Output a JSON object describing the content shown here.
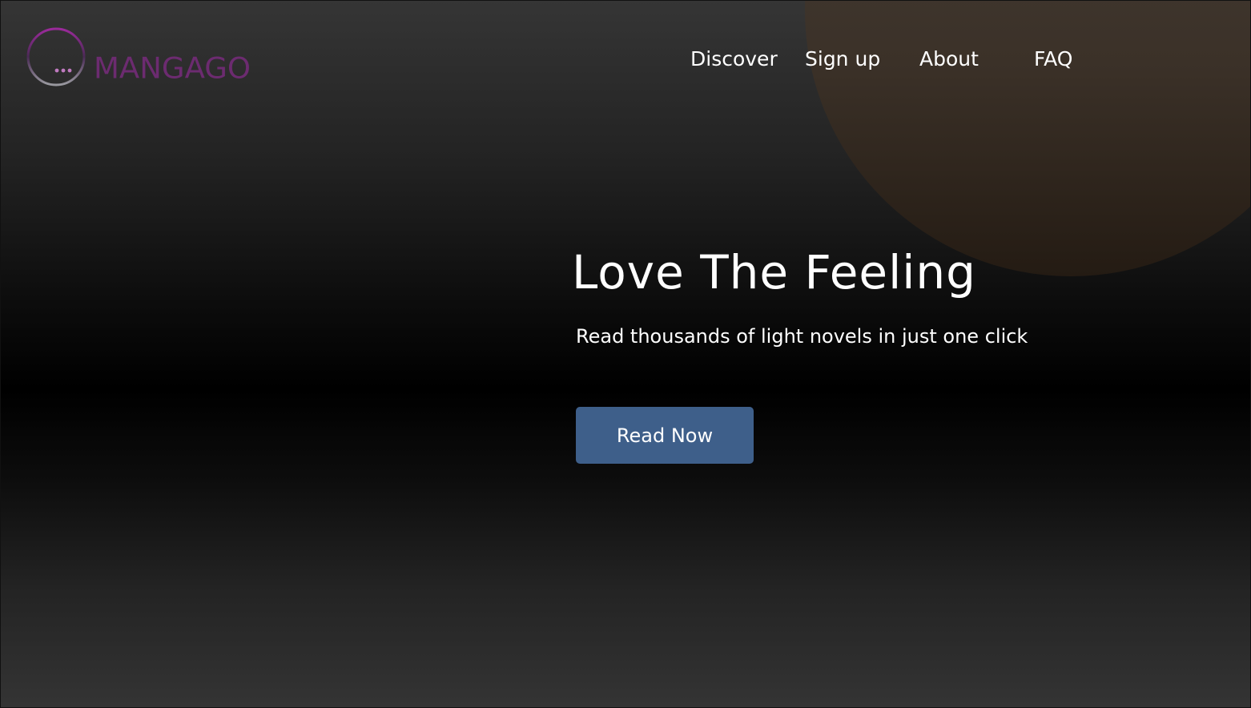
{
  "brand": {
    "name": "MANGAGO",
    "logo_icon": "ellipsis-ring-icon",
    "logo_gradient": [
      "#9b2a9b",
      "#5a2a63",
      "#9a9aa0"
    ]
  },
  "nav": {
    "items": [
      {
        "label": "Discover"
      },
      {
        "label": "Sign up"
      },
      {
        "label": "About"
      },
      {
        "label": "FAQ"
      }
    ]
  },
  "hero": {
    "title": "Love The Feeling",
    "subtitle": "Read thousands of light novels in just one click",
    "cta_label": "Read Now"
  },
  "colors": {
    "cta_background": "#3e5f8a",
    "decor_circle": "#3d342b",
    "text": "#ffffff"
  }
}
